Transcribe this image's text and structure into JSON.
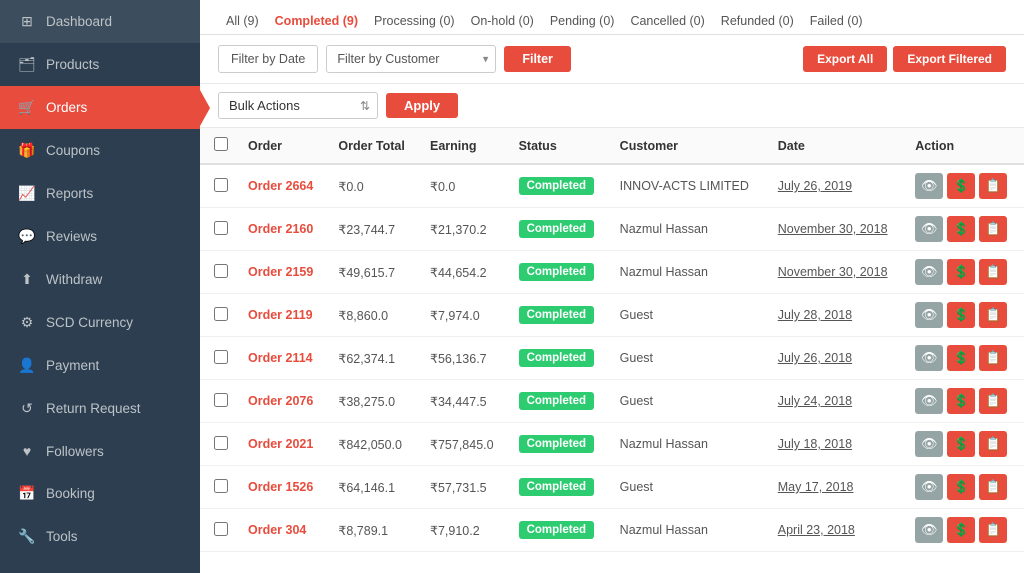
{
  "sidebar": {
    "items": [
      {
        "label": "Dashboard",
        "icon": "⊞",
        "id": "dashboard",
        "active": false
      },
      {
        "label": "Products",
        "icon": "🗂",
        "id": "products",
        "active": false
      },
      {
        "label": "Orders",
        "icon": "🛒",
        "id": "orders",
        "active": true
      },
      {
        "label": "Coupons",
        "icon": "🎁",
        "id": "coupons",
        "active": false
      },
      {
        "label": "Reports",
        "icon": "📈",
        "id": "reports",
        "active": false
      },
      {
        "label": "Reviews",
        "icon": "💬",
        "id": "reviews",
        "active": false
      },
      {
        "label": "Withdraw",
        "icon": "⬆",
        "id": "withdraw",
        "active": false
      },
      {
        "label": "SCD Currency",
        "icon": "⚙",
        "id": "scd-currency",
        "active": false
      },
      {
        "label": "Payment",
        "icon": "👤",
        "id": "payment",
        "active": false
      },
      {
        "label": "Return Request",
        "icon": "↺",
        "id": "return-request",
        "active": false
      },
      {
        "label": "Followers",
        "icon": "♥",
        "id": "followers",
        "active": false
      },
      {
        "label": "Booking",
        "icon": "📅",
        "id": "booking",
        "active": false
      },
      {
        "label": "Tools",
        "icon": "🔧",
        "id": "tools",
        "active": false
      }
    ]
  },
  "tabs": [
    {
      "label": "All (9)",
      "active": false
    },
    {
      "label": "Completed (9)",
      "active": true
    },
    {
      "label": "Processing (0)",
      "active": false
    },
    {
      "label": "On-hold (0)",
      "active": false
    },
    {
      "label": "Pending (0)",
      "active": false
    },
    {
      "label": "Cancelled (0)",
      "active": false
    },
    {
      "label": "Refunded (0)",
      "active": false
    },
    {
      "label": "Failed (0)",
      "active": false
    }
  ],
  "filter": {
    "date_label": "Filter by Date",
    "customer_placeholder": "Filter by Customer",
    "filter_btn": "Filter",
    "export_all": "Export All",
    "export_filtered": "Export Filtered"
  },
  "bulk": {
    "label": "Bulk Actions",
    "apply_label": "Apply"
  },
  "table": {
    "headers": [
      "",
      "Order",
      "Order Total",
      "Earning",
      "Status",
      "Customer",
      "Date",
      "Action"
    ],
    "rows": [
      {
        "order": "Order 2664",
        "total": "₹0.0",
        "earning": "₹0.0",
        "status": "Completed",
        "customer": "INNOV-ACTS LIMITED",
        "date": "July 26, 2019"
      },
      {
        "order": "Order 2160",
        "total": "₹23,744.7",
        "earning": "₹21,370.2",
        "status": "Completed",
        "customer": "Nazmul Hassan",
        "date": "November 30, 2018"
      },
      {
        "order": "Order 2159",
        "total": "₹49,615.7",
        "earning": "₹44,654.2",
        "status": "Completed",
        "customer": "Nazmul Hassan",
        "date": "November 30, 2018"
      },
      {
        "order": "Order 2119",
        "total": "₹8,860.0",
        "earning": "₹7,974.0",
        "status": "Completed",
        "customer": "Guest",
        "date": "July 28, 2018"
      },
      {
        "order": "Order 2114",
        "total": "₹62,374.1",
        "earning": "₹56,136.7",
        "status": "Completed",
        "customer": "Guest",
        "date": "July 26, 2018"
      },
      {
        "order": "Order 2076",
        "total": "₹38,275.0",
        "earning": "₹34,447.5",
        "status": "Completed",
        "customer": "Guest",
        "date": "July 24, 2018"
      },
      {
        "order": "Order 2021",
        "total": "₹842,050.0",
        "earning": "₹757,845.0",
        "status": "Completed",
        "customer": "Nazmul Hassan",
        "date": "July 18, 2018"
      },
      {
        "order": "Order 1526",
        "total": "₹64,146.1",
        "earning": "₹57,731.5",
        "status": "Completed",
        "customer": "Guest",
        "date": "May 17, 2018"
      },
      {
        "order": "Order 304",
        "total": "₹8,789.1",
        "earning": "₹7,910.2",
        "status": "Completed",
        "customer": "Nazmul Hassan",
        "date": "April 23, 2018"
      }
    ]
  }
}
